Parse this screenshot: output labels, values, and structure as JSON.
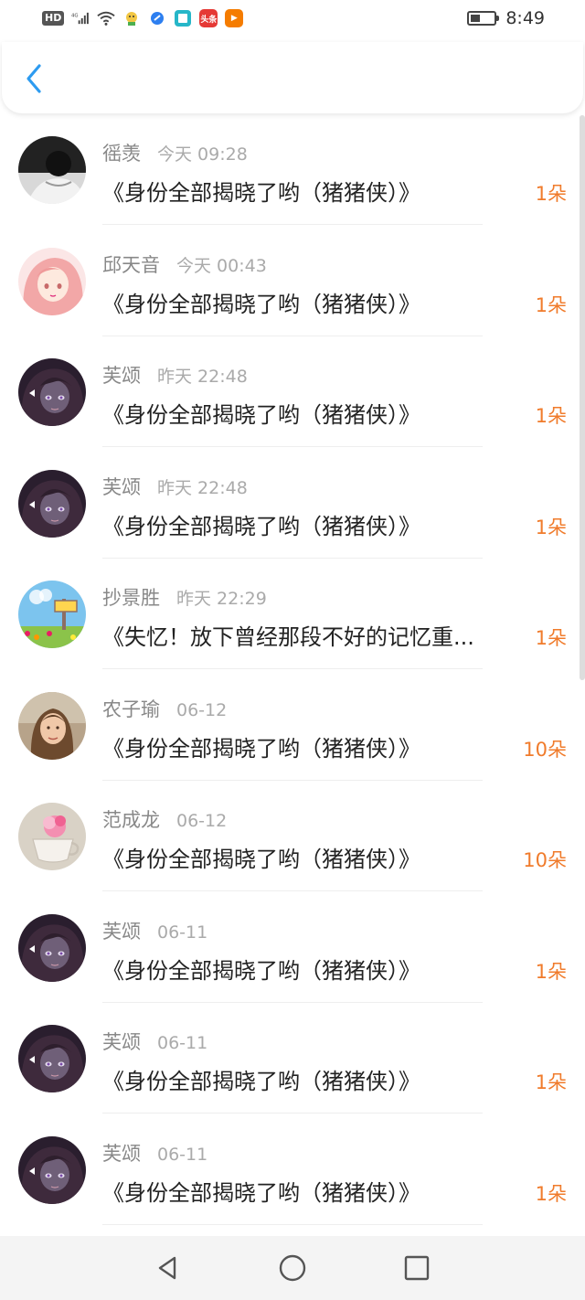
{
  "status_bar": {
    "hd": "HD",
    "network": "4G",
    "app_icons": [
      {
        "name": "toutiao-app-icon",
        "label": "头条",
        "color": "#e53935"
      },
      {
        "name": "video-app-icon",
        "label": "▶",
        "color": "#f57c00"
      }
    ],
    "time": "8:49"
  },
  "header": {
    "back_icon": "chevron-left-icon",
    "accent": "#2d9bf0"
  },
  "accent_count_color": "#f07b2b",
  "items": [
    {
      "name": "徭羡",
      "time": "今天 09:28",
      "book": "《身份全部揭晓了哟（猪猪侠）》",
      "count": "1朵",
      "avatar": "mono-portrait"
    },
    {
      "name": "邱天音",
      "time": "今天 00:43",
      "book": "《身份全部揭晓了哟（猪猪侠）》",
      "count": "1朵",
      "avatar": "pink-anime-girl"
    },
    {
      "name": "芙颂",
      "time": "昨天 22:48",
      "book": "《身份全部揭晓了哟（猪猪侠）》",
      "count": "1朵",
      "avatar": "dark-anime-girl"
    },
    {
      "name": "芙颂",
      "time": "昨天 22:48",
      "book": "《身份全部揭晓了哟（猪猪侠）》",
      "count": "1朵",
      "avatar": "dark-anime-girl"
    },
    {
      "name": "抄景胜",
      "time": "昨天 22:29",
      "book": "《失忆！放下曾经那段不好的记忆重...",
      "count": "1朵",
      "avatar": "sky-meadow-sign"
    },
    {
      "name": "农子瑜",
      "time": "06-12",
      "book": "《身份全部揭晓了哟（猪猪侠）》",
      "count": "10朵",
      "avatar": "photo-woman"
    },
    {
      "name": "范成龙",
      "time": "06-12",
      "book": "《身份全部揭晓了哟（猪猪侠）》",
      "count": "10朵",
      "avatar": "flower-cup"
    },
    {
      "name": "芙颂",
      "time": "06-11",
      "book": "《身份全部揭晓了哟（猪猪侠）》",
      "count": "1朵",
      "avatar": "dark-anime-girl"
    },
    {
      "name": "芙颂",
      "time": "06-11",
      "book": "《身份全部揭晓了哟（猪猪侠）》",
      "count": "1朵",
      "avatar": "dark-anime-girl"
    },
    {
      "name": "芙颂",
      "time": "06-11",
      "book": "《身份全部揭晓了哟（猪猪侠）》",
      "count": "1朵",
      "avatar": "dark-anime-girl"
    }
  ],
  "nav_bar": {
    "back": "triangle-back-icon",
    "home": "circle-home-icon",
    "recents": "square-recents-icon"
  }
}
